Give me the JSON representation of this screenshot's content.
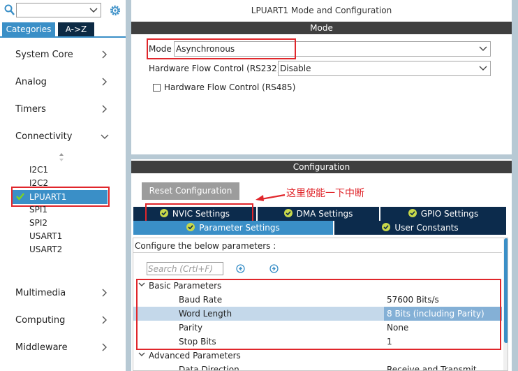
{
  "left_panel": {
    "search_value": "",
    "tabs": {
      "categories": "Categories",
      "atoz": "A->Z"
    },
    "categories": [
      {
        "label": "System Core"
      },
      {
        "label": "Analog"
      },
      {
        "label": "Timers"
      },
      {
        "label": "Connectivity"
      },
      {
        "label": "Multimedia"
      },
      {
        "label": "Computing"
      },
      {
        "label": "Middleware"
      }
    ],
    "peripherals": [
      "I2C1",
      "I2C2",
      "LPUART1",
      "SPI1",
      "SPI2",
      "USART1",
      "USART2"
    ],
    "selected_peripheral": "LPUART1"
  },
  "main": {
    "title": "LPUART1 Mode and Configuration",
    "mode_section": "Mode",
    "mode_label": "Mode",
    "mode_value": "Asynchronous",
    "hw_flow_232_label": "Hardware Flow Control (RS232)",
    "hw_flow_232_value": "Disable",
    "hw_flow_485_label": "Hardware Flow Control (RS485)",
    "config_section": "Configuration",
    "reset_button": "Reset Configuration",
    "annotation": "这里使能一下中断",
    "tabs": {
      "nvic": "NVIC Settings",
      "dma": "DMA Settings",
      "gpio": "GPIO Settings",
      "params": "Parameter Settings",
      "user_constants": "User Constants"
    },
    "params_hint": "Configure the below parameters :",
    "search_placeholder": "Search (Crtl+F)",
    "basic_group": "Basic Parameters",
    "basic_params": [
      {
        "name": "Baud Rate",
        "value": "57600 Bits/s"
      },
      {
        "name": "Word Length",
        "value": "8 Bits (including Parity)"
      },
      {
        "name": "Parity",
        "value": "None"
      },
      {
        "name": "Stop Bits",
        "value": "1"
      }
    ],
    "advanced_group": "Advanced Parameters",
    "advanced_params": [
      {
        "name": "Data Direction",
        "value": "Receive and Transmit"
      }
    ]
  },
  "colors": {
    "accent_blue": "#3a8fc7",
    "dark_navy": "#0c2b4c",
    "highlight_red": "#e0262b",
    "section_bar": "#3f3f3f"
  },
  "icons": [
    "search-icon",
    "gear-icon",
    "chevron-down-icon",
    "chevron-right-icon",
    "check-icon",
    "sort-arrows-icon",
    "prev-circle-icon",
    "next-circle-icon"
  ]
}
